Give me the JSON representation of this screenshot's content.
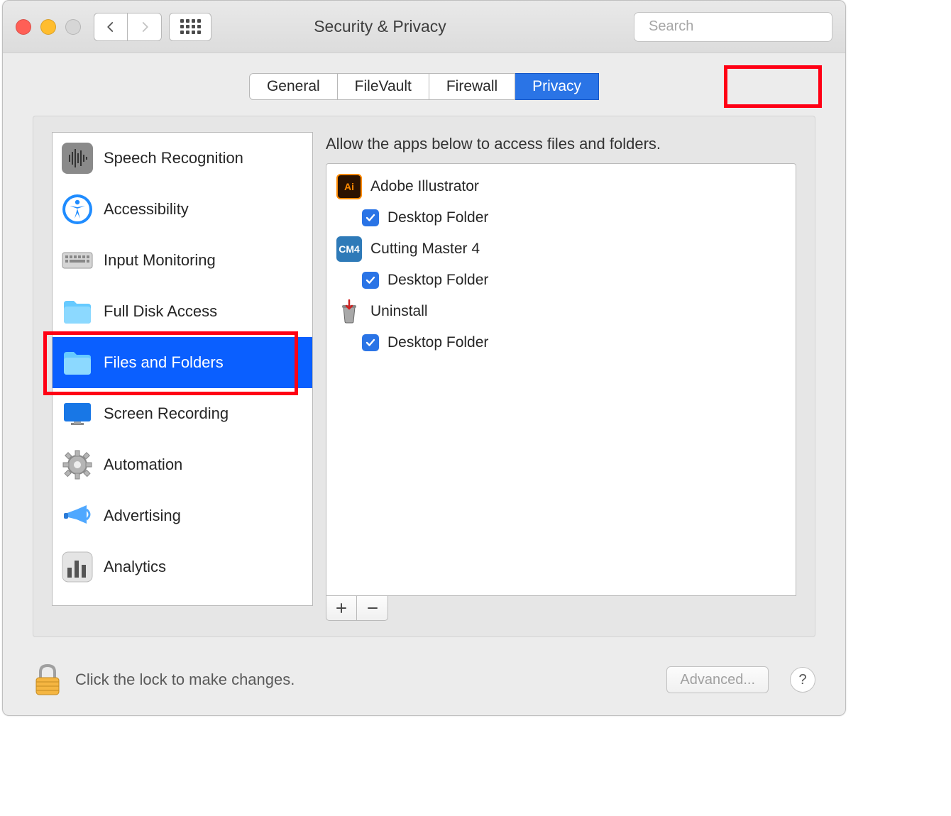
{
  "window": {
    "title": "Security & Privacy"
  },
  "search": {
    "placeholder": "Search"
  },
  "tabs": [
    {
      "label": "General",
      "active": false
    },
    {
      "label": "FileVault",
      "active": false
    },
    {
      "label": "Firewall",
      "active": false
    },
    {
      "label": "Privacy",
      "active": true,
      "highlighted": true
    }
  ],
  "sidebar": {
    "items": [
      {
        "label": "Speech Recognition",
        "icon": "waveform"
      },
      {
        "label": "Accessibility",
        "icon": "accessibility"
      },
      {
        "label": "Input Monitoring",
        "icon": "keyboard"
      },
      {
        "label": "Full Disk Access",
        "icon": "folder"
      },
      {
        "label": "Files and Folders",
        "icon": "folder",
        "selected": true,
        "highlighted": true
      },
      {
        "label": "Screen Recording",
        "icon": "display"
      },
      {
        "label": "Automation",
        "icon": "gear"
      },
      {
        "label": "Advertising",
        "icon": "megaphone"
      },
      {
        "label": "Analytics",
        "icon": "bars"
      }
    ]
  },
  "detail": {
    "header": "Allow the apps below to access files and folders.",
    "apps": [
      {
        "name": "Adobe Illustrator",
        "icon": "ai",
        "permissions": [
          {
            "label": "Desktop Folder",
            "checked": true
          }
        ]
      },
      {
        "name": "Cutting Master 4",
        "icon": "cm4",
        "permissions": [
          {
            "label": "Desktop Folder",
            "checked": true
          }
        ]
      },
      {
        "name": "Uninstall",
        "icon": "uninstall",
        "permissions": [
          {
            "label": "Desktop Folder",
            "checked": true
          }
        ]
      }
    ]
  },
  "footer": {
    "lock_text": "Click the lock to make changes.",
    "advanced_label": "Advanced...",
    "help_label": "?"
  }
}
